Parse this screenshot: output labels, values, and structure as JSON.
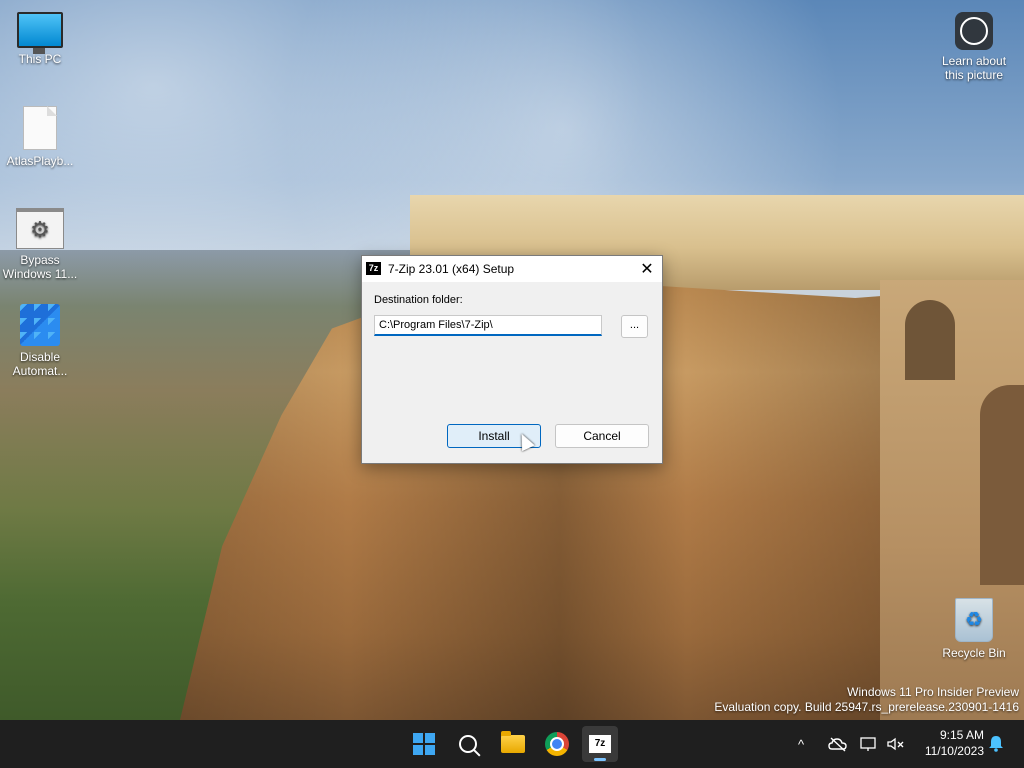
{
  "desktop": {
    "icons": [
      {
        "label": "This PC"
      },
      {
        "label": "AtlasPlayb..."
      },
      {
        "label": "Bypass Windows 11..."
      },
      {
        "label": "Disable Automat..."
      },
      {
        "label": "Learn about this picture"
      },
      {
        "label": "Recycle Bin"
      }
    ],
    "watermark": {
      "line1": "Windows 11 Pro Insider Preview",
      "line2": "Evaluation copy. Build 25947.rs_prerelease.230901-1416"
    }
  },
  "dialog": {
    "title": "7-Zip 23.01 (x64) Setup",
    "title_icon_text": "7z",
    "close_glyph": "✕",
    "destination_label": "Destination folder:",
    "destination_value": "C:\\Program Files\\7-Zip\\",
    "browse_label": "...",
    "install_label": "Install",
    "cancel_label": "Cancel"
  },
  "taskbar": {
    "apps": [
      {
        "name": "start-icon"
      },
      {
        "name": "search-icon"
      },
      {
        "name": "file-explorer-icon"
      },
      {
        "name": "chrome-icon"
      },
      {
        "name": "7zip-icon",
        "text": "7z",
        "active": true
      }
    ],
    "tray": {
      "chevron_glyph": "^",
      "time": "9:15 AM",
      "date": "11/10/2023"
    }
  },
  "colors": {
    "accent": "#0067c0",
    "taskbar_bg": "#1f1f1f"
  }
}
